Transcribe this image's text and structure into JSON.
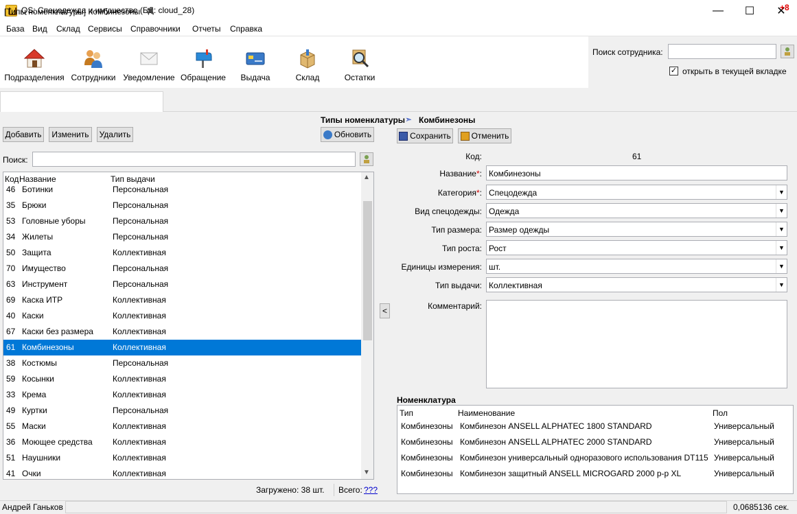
{
  "window": {
    "title": "QS: Спецодежда и имущество (БД: cloud_28)",
    "minimize": "—",
    "maximize": "☐",
    "close": "✕"
  },
  "menu": {
    "items": [
      "База",
      "Вид",
      "Склад",
      "Сервисы",
      "Справочники",
      "Отчеты",
      "Справка"
    ],
    "badge": "+8"
  },
  "toolbar": {
    "buttons": [
      {
        "label": "Подразделения",
        "icon": "house-icon"
      },
      {
        "label": "Сотрудники",
        "icon": "people-icon"
      },
      {
        "label": "Уведомление",
        "icon": "envelope-icon"
      },
      {
        "label": "Обращение",
        "icon": "mailbox-icon"
      },
      {
        "label": "Выдача",
        "icon": "card-icon"
      },
      {
        "label": "Склад",
        "icon": "box-icon"
      },
      {
        "label": "Остатки",
        "icon": "magnifier-icon"
      }
    ]
  },
  "employee_search": {
    "label": "Поиск сотрудника:",
    "value": "",
    "open_in_tab_label": "открыть в текущей вкладке",
    "open_in_tab_checked": true
  },
  "doc_tab": {
    "label": "[Типы номенклатуры] Комбинезоны"
  },
  "breadcrumb": {
    "left": "Типы номенклатуры",
    "arrow": "➣",
    "right": "Комбинезоны"
  },
  "list_panel": {
    "buttons": {
      "add": "Добавить",
      "edit": "Изменить",
      "delete": "Удалить",
      "refresh": "Обновить"
    },
    "search_label": "Поиск:",
    "search_value": "",
    "columns": {
      "code": "Код",
      "name": "Название",
      "issue_type": "Тип выдачи"
    },
    "rows": [
      {
        "code": "46",
        "name": "Ботинки",
        "type": "Персональная"
      },
      {
        "code": "35",
        "name": "Брюки",
        "type": "Персональная"
      },
      {
        "code": "53",
        "name": "Головные уборы",
        "type": "Персональная"
      },
      {
        "code": "34",
        "name": "Жилеты",
        "type": "Персональная"
      },
      {
        "code": "50",
        "name": "Защита",
        "type": "Коллективная"
      },
      {
        "code": "70",
        "name": "Имущество",
        "type": "Персональная"
      },
      {
        "code": "63",
        "name": "Инструмент",
        "type": "Персональная"
      },
      {
        "code": "69",
        "name": "Каска ИТР",
        "type": "Коллективная"
      },
      {
        "code": "40",
        "name": "Каски",
        "type": "Коллективная"
      },
      {
        "code": "67",
        "name": "Каски без размера",
        "type": "Коллективная"
      },
      {
        "code": "61",
        "name": "Комбинезоны",
        "type": "Коллективная",
        "selected": true
      },
      {
        "code": "38",
        "name": "Костюмы",
        "type": "Персональная"
      },
      {
        "code": "59",
        "name": "Косынки",
        "type": "Коллективная"
      },
      {
        "code": "33",
        "name": "Крема",
        "type": "Коллективная"
      },
      {
        "code": "49",
        "name": "Куртки",
        "type": "Персональная"
      },
      {
        "code": "55",
        "name": "Маски",
        "type": "Коллективная"
      },
      {
        "code": "36",
        "name": "Моющее средства",
        "type": "Коллективная"
      },
      {
        "code": "51",
        "name": "Наушники",
        "type": "Коллективная"
      },
      {
        "code": "41",
        "name": "Очки",
        "type": "Коллективная"
      }
    ],
    "loaded": "Загружено: 38 шт.",
    "total_label": "Всего:",
    "total_value": "???"
  },
  "splitter": "<",
  "form": {
    "save": "Сохранить",
    "cancel": "Отменить",
    "code_label": "Код:",
    "code_value": "61",
    "name_label": "Название",
    "name_value": "Комбинезоны",
    "category_label": "Категория",
    "category_value": "Спецодежда",
    "clothing_kind_label": "Вид спецодежды:",
    "clothing_kind_value": "Одежда",
    "size_type_label": "Тип размера:",
    "size_type_value": "Размер одежды",
    "height_type_label": "Тип роста:",
    "height_type_value": "Рост",
    "units_label": "Единицы измерения:",
    "units_value": "шт.",
    "issue_type_label": "Тип выдачи:",
    "issue_type_value": "Коллективная",
    "comment_label": "Комментарий:",
    "comment_value": "",
    "required_mark": "*",
    "colon": ":"
  },
  "nomenclature": {
    "title": "Номенклатура",
    "columns": {
      "type": "Тип",
      "name": "Наименование",
      "gender": "Пол"
    },
    "rows": [
      {
        "type": "Комбинезоны",
        "name": "Комбинезон ANSELL ALPHATEC 1800 STANDARD",
        "gender": "Универсальный"
      },
      {
        "type": "Комбинезоны",
        "name": "Комбинезон ANSELL ALPHATEC 2000 STANDARD",
        "gender": "Универсальный"
      },
      {
        "type": "Комбинезоны",
        "name": "Комбинезон универсальный одноразового использования DT115",
        "gender": "Универсальный"
      },
      {
        "type": "Комбинезоны",
        "name": "Комбинезон защитный ANSELL MICROGARD 2000 р-р XL",
        "gender": "Универсальный"
      }
    ]
  },
  "status": {
    "user": "Андрей Ганьков",
    "time": "0,0685136 сек."
  },
  "colors": {
    "selection": "#0078d7",
    "required": "#d00000",
    "link": "#0000cc",
    "badge": "#e00000"
  }
}
